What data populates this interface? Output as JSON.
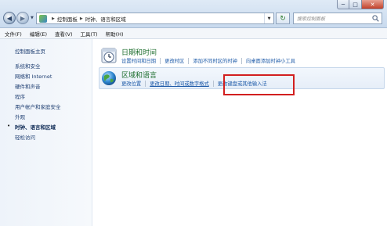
{
  "window": {
    "min_glyph": "─",
    "max_glyph": "□",
    "close_glyph": "✕"
  },
  "address": {
    "crumbs": [
      "控制面板",
      "时钟、语言和区域"
    ],
    "dropdown_glyph": "▼",
    "refresh_glyph": "↻"
  },
  "search": {
    "placeholder": "搜索控制面板"
  },
  "nav": {
    "back_glyph": "◀",
    "forward_glyph": "▶",
    "dropdown_glyph": "▼"
  },
  "menubar": {
    "items": [
      "文件(F)",
      "编辑(E)",
      "查看(V)",
      "工具(T)",
      "帮助(H)"
    ]
  },
  "sidebar": {
    "home": "控制面板主页",
    "items": [
      "系统和安全",
      "网络和 Internet",
      "硬件和声音",
      "程序",
      "用户帐户和家庭安全",
      "外观",
      "时钟、语言和区域",
      "轻松访问"
    ],
    "active_index": 6,
    "bullet": "•"
  },
  "categories": [
    {
      "title": "日期和时间",
      "icon": "clock-icon",
      "links": [
        "设置时间和日期",
        "更改时区",
        "添加不同时区的时钟",
        "向桌面添加时钟小工具"
      ]
    },
    {
      "title": "区域和语言",
      "icon": "globe-icon",
      "links": [
        "更改位置",
        "更改日期、时间或数字格式",
        "更改键盘或其他输入法"
      ]
    }
  ],
  "colors": {
    "accent_link": "#1d5aa8",
    "category_title": "#1e6e2e",
    "highlight_box": "#d21f1f"
  }
}
